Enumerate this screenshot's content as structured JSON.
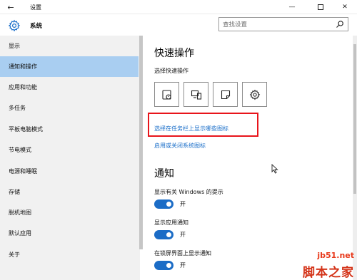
{
  "window": {
    "title": "设置",
    "back_glyph": "←",
    "min_glyph": "—",
    "close_glyph": "✕"
  },
  "header": {
    "title": "系统",
    "search_placeholder": "查找设置"
  },
  "sidebar": {
    "items": [
      {
        "label": "显示",
        "active": false
      },
      {
        "label": "通知和操作",
        "active": true
      },
      {
        "label": "应用和功能",
        "active": false
      },
      {
        "label": "多任务",
        "active": false
      },
      {
        "label": "平板电脑模式",
        "active": false
      },
      {
        "label": "节电模式",
        "active": false
      },
      {
        "label": "电源和睡眠",
        "active": false
      },
      {
        "label": "存储",
        "active": false
      },
      {
        "label": "脱机地图",
        "active": false
      },
      {
        "label": "默认应用",
        "active": false
      },
      {
        "label": "关于",
        "active": false
      }
    ]
  },
  "main": {
    "quick_actions": {
      "title": "快速操作",
      "subtitle": "选择快速操作",
      "tiles": [
        "tablet-mode-icon",
        "connect-display-icon",
        "note-icon",
        "settings-icon"
      ]
    },
    "links": {
      "taskbar_icons": "选择在任务栏上显示哪些图标",
      "system_icons": "启用或关闭系统图标"
    },
    "notifications": {
      "title": "通知",
      "options": [
        {
          "label": "显示有关 Windows 的提示",
          "state": "开",
          "on": true
        },
        {
          "label": "显示应用通知",
          "state": "开",
          "on": true
        },
        {
          "label": "在锁屏界面上显示通知",
          "state": "开",
          "on": true
        }
      ]
    }
  },
  "watermark": {
    "url": "jb51.net",
    "name": "脚本之家"
  },
  "colors": {
    "accent": "#1a6ec9",
    "active_item": "#a9cef1",
    "highlight_box": "#e8141b",
    "toggle_on": "#1b6cc6"
  }
}
